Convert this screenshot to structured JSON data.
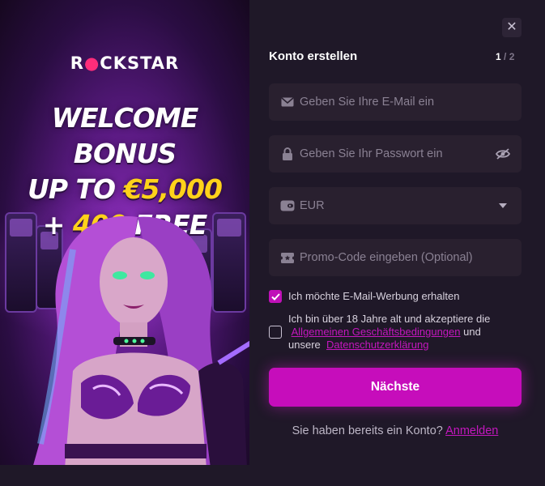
{
  "promo": {
    "logo_text_a": "R",
    "logo_text_b": "CKSTAR",
    "headline_line1": "WELCOME BONUS",
    "headline_line2_a": "UP TO ",
    "headline_line2_b": "€5,000",
    "headline_line3_a": "+ ",
    "headline_line3_b": "400",
    "headline_line3_c": " FREE SPINS"
  },
  "form": {
    "title": "Konto erstellen",
    "step_current": "1",
    "step_total": "/ 2",
    "email_placeholder": "Geben Sie Ihre E-Mail ein",
    "password_placeholder": "Geben Sie Ihr Passwort ein",
    "currency_value": "EUR",
    "promo_placeholder": "Promo-Code eingeben (Optional)",
    "marketing_label": "Ich möchte E-Mail-Werbung erhalten",
    "marketing_checked": true,
    "terms_text_1": "Ich bin über 18 Jahre alt und akzeptiere die",
    "terms_link": "Allgemeinen Geschäftsbedingungen",
    "terms_text_2": "und",
    "terms_text_3": "unsere",
    "privacy_link": "Datenschutzerklärung",
    "terms_checked": false,
    "submit_label": "Nächste",
    "login_prompt": "Sie haben bereits ein Konto?",
    "login_link": "Anmelden"
  },
  "icons": {
    "close": "close-icon",
    "email": "envelope-icon",
    "password": "lock-icon",
    "visibility": "eye-off-icon",
    "currency": "wallet-icon",
    "dropdown": "caret-down-icon",
    "promo": "ticket-icon",
    "check": "checkmark-icon"
  },
  "colors": {
    "accent": "#c60dbb",
    "background": "#1f1828",
    "field": "#29202f",
    "headline_yellow": "#ffd21a"
  }
}
